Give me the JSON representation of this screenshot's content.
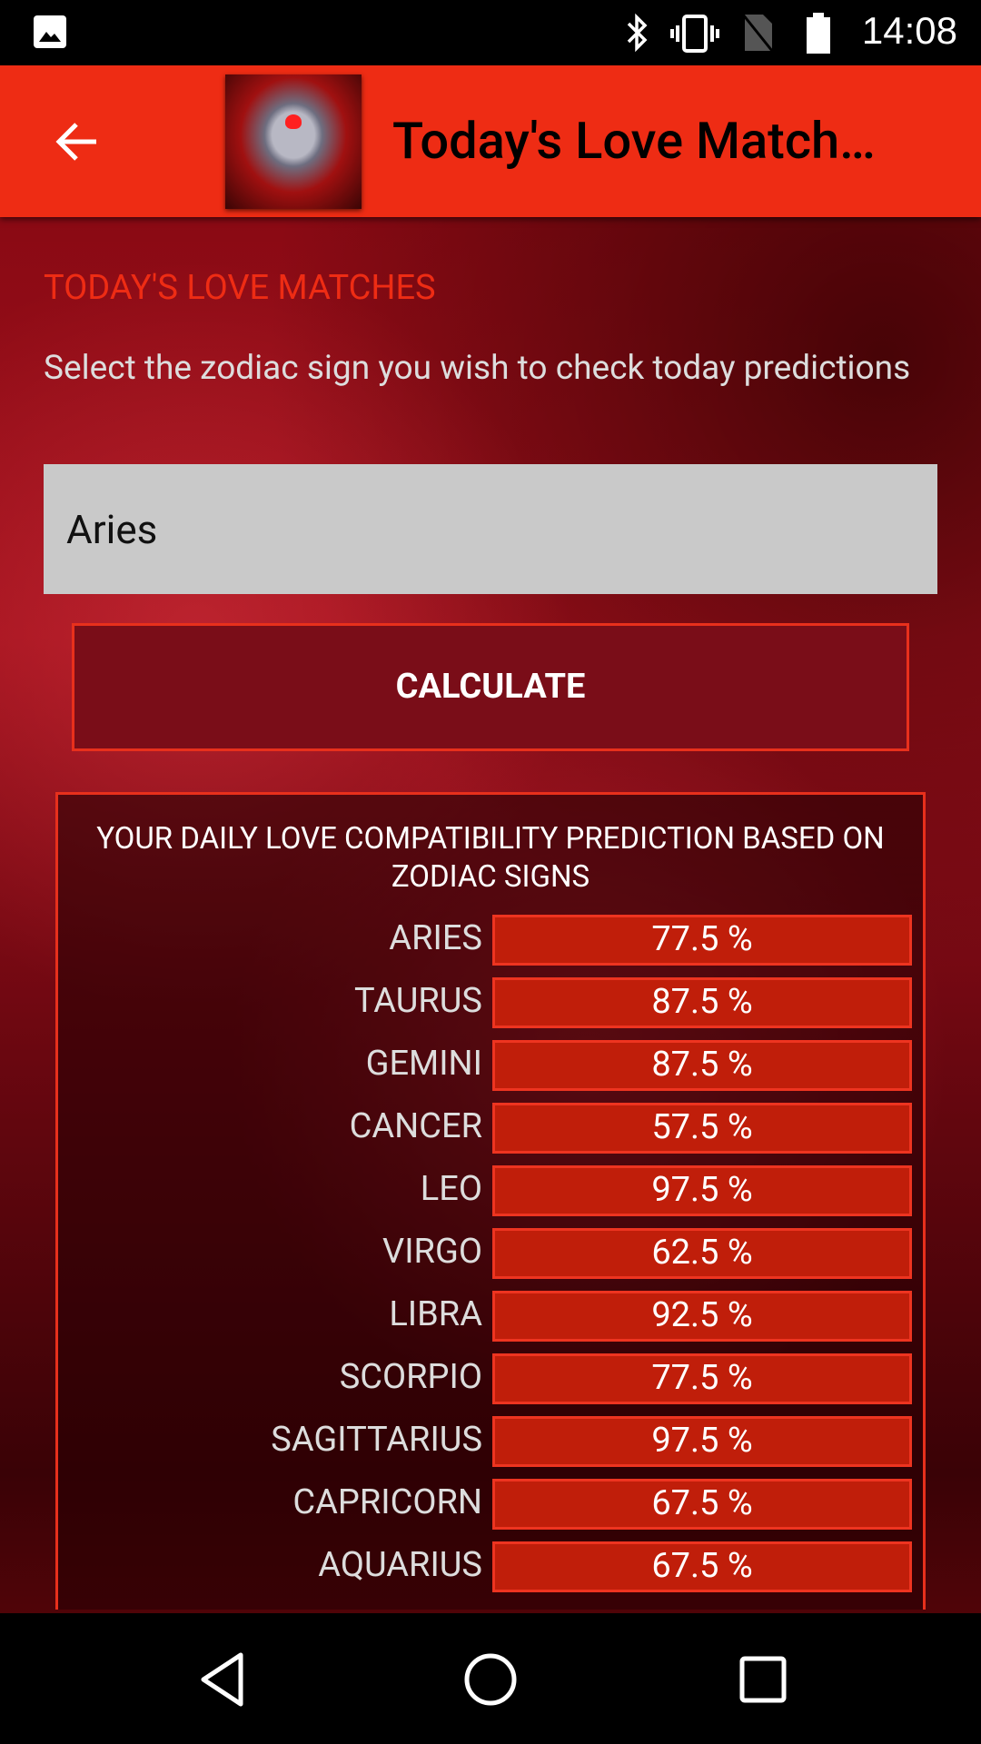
{
  "status_bar": {
    "time": "14:08",
    "icons": [
      "image-icon",
      "bluetooth-icon",
      "vibrate-icon",
      "no-sim-icon",
      "battery-icon"
    ]
  },
  "toolbar": {
    "title": "Today's Love Match…",
    "back_icon": "arrow-left-icon"
  },
  "main": {
    "heading": "TODAY'S LOVE MATCHES",
    "subtitle": "Select the zodiac sign you wish to check today predictions",
    "selected_sign": "Aries",
    "calculate_label": "CALCULATE",
    "results": {
      "title": "YOUR DAILY LOVE COMPATIBILITY PREDICTION BASED ON ZODIAC SIGNS",
      "rows": [
        {
          "sign": "ARIES",
          "value": "77.5 %"
        },
        {
          "sign": "TAURUS",
          "value": "87.5 %"
        },
        {
          "sign": "GEMINI",
          "value": "87.5 %"
        },
        {
          "sign": "CANCER",
          "value": "57.5 %"
        },
        {
          "sign": "LEO",
          "value": "97.5 %"
        },
        {
          "sign": "VIRGO",
          "value": "62.5 %"
        },
        {
          "sign": "LIBRA",
          "value": "92.5 %"
        },
        {
          "sign": "SCORPIO",
          "value": "77.5 %"
        },
        {
          "sign": "SAGITTARIUS",
          "value": "97.5 %"
        },
        {
          "sign": "CAPRICORN",
          "value": "67.5 %"
        },
        {
          "sign": "AQUARIUS",
          "value": "67.5 %"
        }
      ]
    }
  },
  "colors": {
    "toolbar": "#ee2c14",
    "button": "#7a0d18",
    "bar": "#c01e0a",
    "accent": "#ee2c14"
  },
  "nav_bar": {
    "icons": [
      "back-triangle-icon",
      "home-circle-icon",
      "recents-square-icon"
    ]
  }
}
